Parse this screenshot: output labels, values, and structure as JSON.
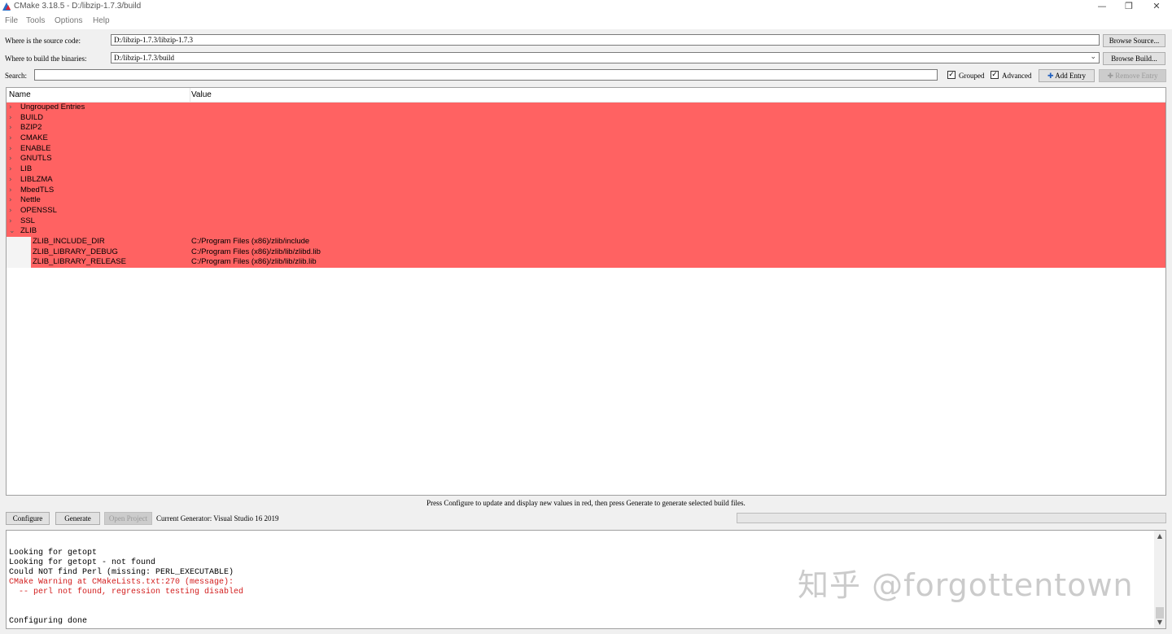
{
  "window": {
    "title": "CMake 3.18.5 - D:/libzip-1.7.3/build",
    "minimize": "—",
    "maximize": "❐",
    "close": "✕"
  },
  "menu": [
    "File",
    "Tools",
    "Options",
    "Help"
  ],
  "source": {
    "label": "Where is the source code:",
    "value": "D:/libzip-1.7.3/libzip-1.7.3",
    "browse": "Browse Source..."
  },
  "build": {
    "label": "Where to build the binaries:",
    "value": "D:/libzip-1.7.3/build",
    "browse": "Browse Build..."
  },
  "search": {
    "label": "Search:",
    "value": "",
    "grouped_label": "Grouped",
    "grouped_checked": true,
    "advanced_label": "Advanced",
    "advanced_checked": true,
    "add_entry": "Add Entry",
    "remove_entry": "Remove Entry"
  },
  "tree": {
    "columns": [
      "Name",
      "Value"
    ],
    "groups": [
      {
        "name": "Ungrouped Entries",
        "expanded": false
      },
      {
        "name": "BUILD",
        "expanded": false
      },
      {
        "name": "BZIP2",
        "expanded": false
      },
      {
        "name": "CMAKE",
        "expanded": false
      },
      {
        "name": "ENABLE",
        "expanded": false
      },
      {
        "name": "GNUTLS",
        "expanded": false
      },
      {
        "name": "LIB",
        "expanded": false
      },
      {
        "name": "LIBLZMA",
        "expanded": false
      },
      {
        "name": "MbedTLS",
        "expanded": false
      },
      {
        "name": "Nettle",
        "expanded": false
      },
      {
        "name": "OPENSSL",
        "expanded": false
      },
      {
        "name": "SSL",
        "expanded": false
      },
      {
        "name": "ZLIB",
        "expanded": true,
        "children": [
          {
            "name": "ZLIB_INCLUDE_DIR",
            "value": "C:/Program Files (x86)/zlib/include"
          },
          {
            "name": "ZLIB_LIBRARY_DEBUG",
            "value": "C:/Program Files (x86)/zlib/lib/zlibd.lib"
          },
          {
            "name": "ZLIB_LIBRARY_RELEASE",
            "value": "C:/Program Files (x86)/zlib/lib/zlib.lib"
          }
        ]
      }
    ],
    "highlight_color": "#ff6262"
  },
  "hint": "Press Configure to update and display new values in red, then press Generate to generate selected build files.",
  "actions": {
    "configure": "Configure",
    "generate": "Generate",
    "open_project": "Open Project",
    "generator": "Current Generator: Visual Studio 16 2019"
  },
  "output": {
    "lines": [
      {
        "text": "Looking for getopt",
        "type": "normal"
      },
      {
        "text": "Looking for getopt - not found",
        "type": "normal"
      },
      {
        "text": "Could NOT find Perl (missing: PERL_EXECUTABLE)",
        "type": "normal"
      },
      {
        "text": "CMake Warning at CMakeLists.txt:270 (message):",
        "type": "warning"
      },
      {
        "text": "  -- perl not found, regression testing disabled",
        "type": "warning"
      },
      {
        "text": "",
        "type": "normal"
      },
      {
        "text": "",
        "type": "normal"
      },
      {
        "text": "Configuring done",
        "type": "normal"
      }
    ],
    "warning_color": "#d21c1c"
  },
  "watermark": "知乎 @forgottentown"
}
